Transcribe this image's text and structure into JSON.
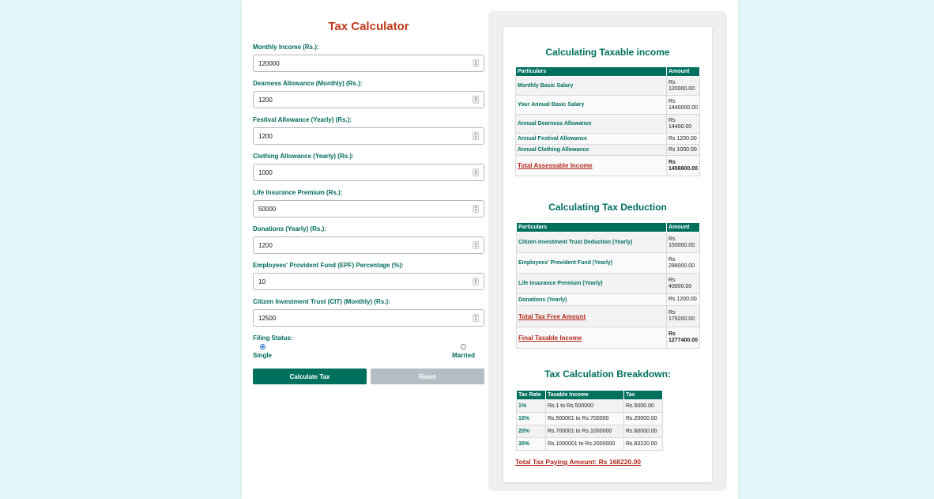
{
  "form": {
    "title": "Tax Calculator",
    "fields": [
      {
        "label": "Monthly Income (Rs.):",
        "value": "120000"
      },
      {
        "label": "Dearness Allowance (Monthly) (Rs.):",
        "value": "1200"
      },
      {
        "label": "Festival Allowance (Yearly) (Rs.):",
        "value": "1200"
      },
      {
        "label": "Clothing Allowance (Yearly) (Rs.):",
        "value": "1000"
      },
      {
        "label": "Life Insurance Premium (Rs.):",
        "value": "50000"
      },
      {
        "label": "Donations (Yearly) (Rs.):",
        "value": "1200"
      },
      {
        "label": "Employees' Provident Fund (EPF) Percentage (%):",
        "value": "10"
      },
      {
        "label": "Citizen Investment Trust (CIT) (Monthly) (Rs.):",
        "value": "12500"
      }
    ],
    "filing_label": "Filing Status:",
    "filing_options": {
      "single": "Single",
      "married": "Married",
      "selected": "single"
    },
    "calculate_label": "Calculate Tax",
    "reset_label": "Reset"
  },
  "taxable": {
    "title": "Calculating Taxable income",
    "headers": [
      "Particulars",
      "Amount"
    ],
    "rows": [
      {
        "label": "Monthly Basic Salary",
        "amount": "Rs 120000.00"
      },
      {
        "label": "Your Annual Basic Salary",
        "amount": "Rs 1440000.00"
      },
      {
        "label": "Annual Dearness Allowance",
        "amount": "Rs 14400.00"
      },
      {
        "label": "Annual Festival Allowance",
        "amount": "Rs 1200.00"
      },
      {
        "label": "Annual Clothing Allowance",
        "amount": "Rs 1000.00"
      }
    ],
    "total": {
      "label": "Total Assessable Income",
      "amount": "Rs 1456600.00"
    }
  },
  "deduction": {
    "title": "Calculating Tax Deduction",
    "headers": [
      "Particulars",
      "Amount"
    ],
    "rows": [
      {
        "label": "Citizen Investment Trust Deduction (Yearly)",
        "amount": "Rs 150000.00"
      },
      {
        "label": "Employees' Provident Fund (Yearly)",
        "amount": "Rs 288000.00"
      },
      {
        "label": "Life Insurance Premium (Yearly)",
        "amount": "Rs 40000.00"
      },
      {
        "label": "Donations (Yearly)",
        "amount": "Rs 1200.00"
      }
    ],
    "total_free": {
      "label": "Total Tax Free Amount",
      "amount": "Rs 179200.00"
    },
    "final": {
      "label": "Final Taxable Income",
      "amount": "Rs 1277400.00"
    }
  },
  "breakdown": {
    "title": "Tax Calculation Breakdown:",
    "headers": [
      "Tax Rate",
      "Taxable Income",
      "Tax"
    ],
    "rows": [
      {
        "rate": "1%",
        "income": "Rs.1 to Rs.500000",
        "tax": "Rs.5000.00"
      },
      {
        "rate": "10%",
        "income": "Rs.500001 to Rs.700000",
        "tax": "Rs.20000.00"
      },
      {
        "rate": "20%",
        "income": "Rs.700001 to Rs.1000000",
        "tax": "Rs.60000.00"
      },
      {
        "rate": "30%",
        "income": "Rs.1000001 to Rs.2000000",
        "tax": "Rs.83220.00"
      }
    ],
    "total": "Total Tax Paying Amount: Rs 168220.00"
  },
  "colors": {
    "accent": "#00705e",
    "title_red": "#c0391b",
    "link_red": "#b3281b",
    "background": "#e3f6f9"
  }
}
